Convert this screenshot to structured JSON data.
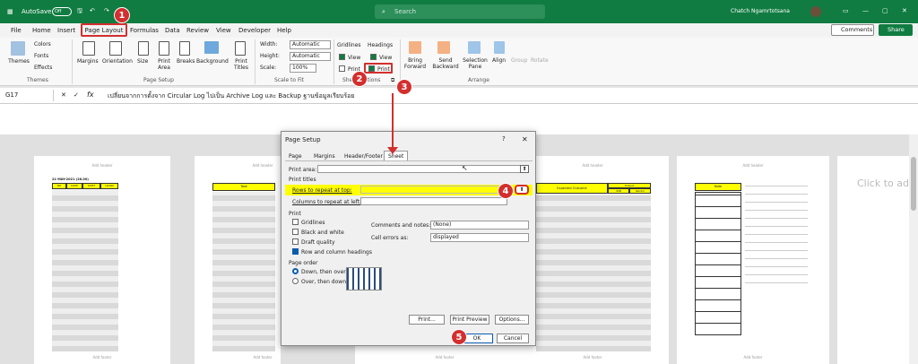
{
  "titlebar": {
    "autosave": "AutoSave",
    "autosave_state": "Off",
    "search_placeholder": "Search",
    "user_name": "Chatch Ngamrtotsana"
  },
  "menu": {
    "items": [
      "File",
      "Home",
      "Insert",
      "Page Layout",
      "Formulas",
      "Data",
      "Review",
      "View",
      "Developer",
      "Help"
    ],
    "comments": "Comments",
    "share": "Share"
  },
  "ribbon": {
    "themes": {
      "themes": "Themes",
      "colors": "Colors",
      "fonts": "Fonts",
      "effects": "Effects",
      "group": "Themes"
    },
    "page_setup": {
      "margins": "Margins",
      "orientation": "Orientation",
      "size": "Size",
      "print_area": "Print Area",
      "breaks": "Breaks",
      "background": "Background",
      "print_titles": "Print Titles",
      "group": "Page Setup"
    },
    "scale": {
      "width": "Width:",
      "height": "Height:",
      "scale": "Scale:",
      "width_val": "Automatic",
      "height_val": "Automatic",
      "scale_val": "100%",
      "group": "Scale to Fit"
    },
    "sheet_options": {
      "gridlines": "Gridlines",
      "headings": "Headings",
      "view": "View",
      "print": "Print",
      "group": "Sheet Options"
    },
    "arrange": {
      "bring_forward": "Bring Forward",
      "send_backward": "Send Backward",
      "selection_pane": "Selection Pane",
      "align": "Align",
      "group_btn": "Group",
      "rotate": "Rotate",
      "group": "Arrange"
    }
  },
  "formulabar": {
    "cell": "G17",
    "fx": "fx",
    "content": "เปลี่ยนจากการตั้งจาก Circular Log ไปเป็น Archive Log และ Backup ฐานข้อมูลเรียบร้อย"
  },
  "sheet": {
    "add_header": "Add header",
    "add_footer": "Add footer",
    "page1_title": "21-MAY-2021 (26.00)",
    "page1_cols": [
      "NO",
      "DATE",
      "SHIFT",
      "LOGIN"
    ],
    "page2_col": "Task",
    "page4_cols": [
      "Expected Outcome",
      "Output",
      "SSB",
      "Vendor"
    ],
    "page5_col": "Note",
    "click_to_add": "Click to add"
  },
  "dialog": {
    "title": "Page Setup",
    "help": "?",
    "tabs": [
      "Page",
      "Margins",
      "Header/Footer",
      "Sheet"
    ],
    "print_area": "Print area:",
    "print_titles": "Print titles",
    "rows_repeat": "Rows to repeat at top:",
    "cols_repeat": "Columns to repeat at left:",
    "print": "Print",
    "gridlines": "Gridlines",
    "bw": "Black and white",
    "draft": "Draft quality",
    "rowcol": "Row and column headings",
    "comments_notes": "Comments and notes:",
    "comments_val": "(None)",
    "cell_errors": "Cell errors as:",
    "cell_errors_val": "displayed",
    "page_order": "Page order",
    "down_over": "Down, then over",
    "over_down": "Over, then down",
    "btn_print": "Print...",
    "btn_preview": "Print Preview",
    "btn_options": "Options...",
    "btn_ok": "OK",
    "btn_cancel": "Cancel"
  },
  "callouts": [
    "1",
    "2",
    "3",
    "4",
    "5"
  ],
  "colors": {
    "excel_green": "#107c41",
    "callout_red": "#d32f2f",
    "highlight_yellow": "#ffff00"
  }
}
